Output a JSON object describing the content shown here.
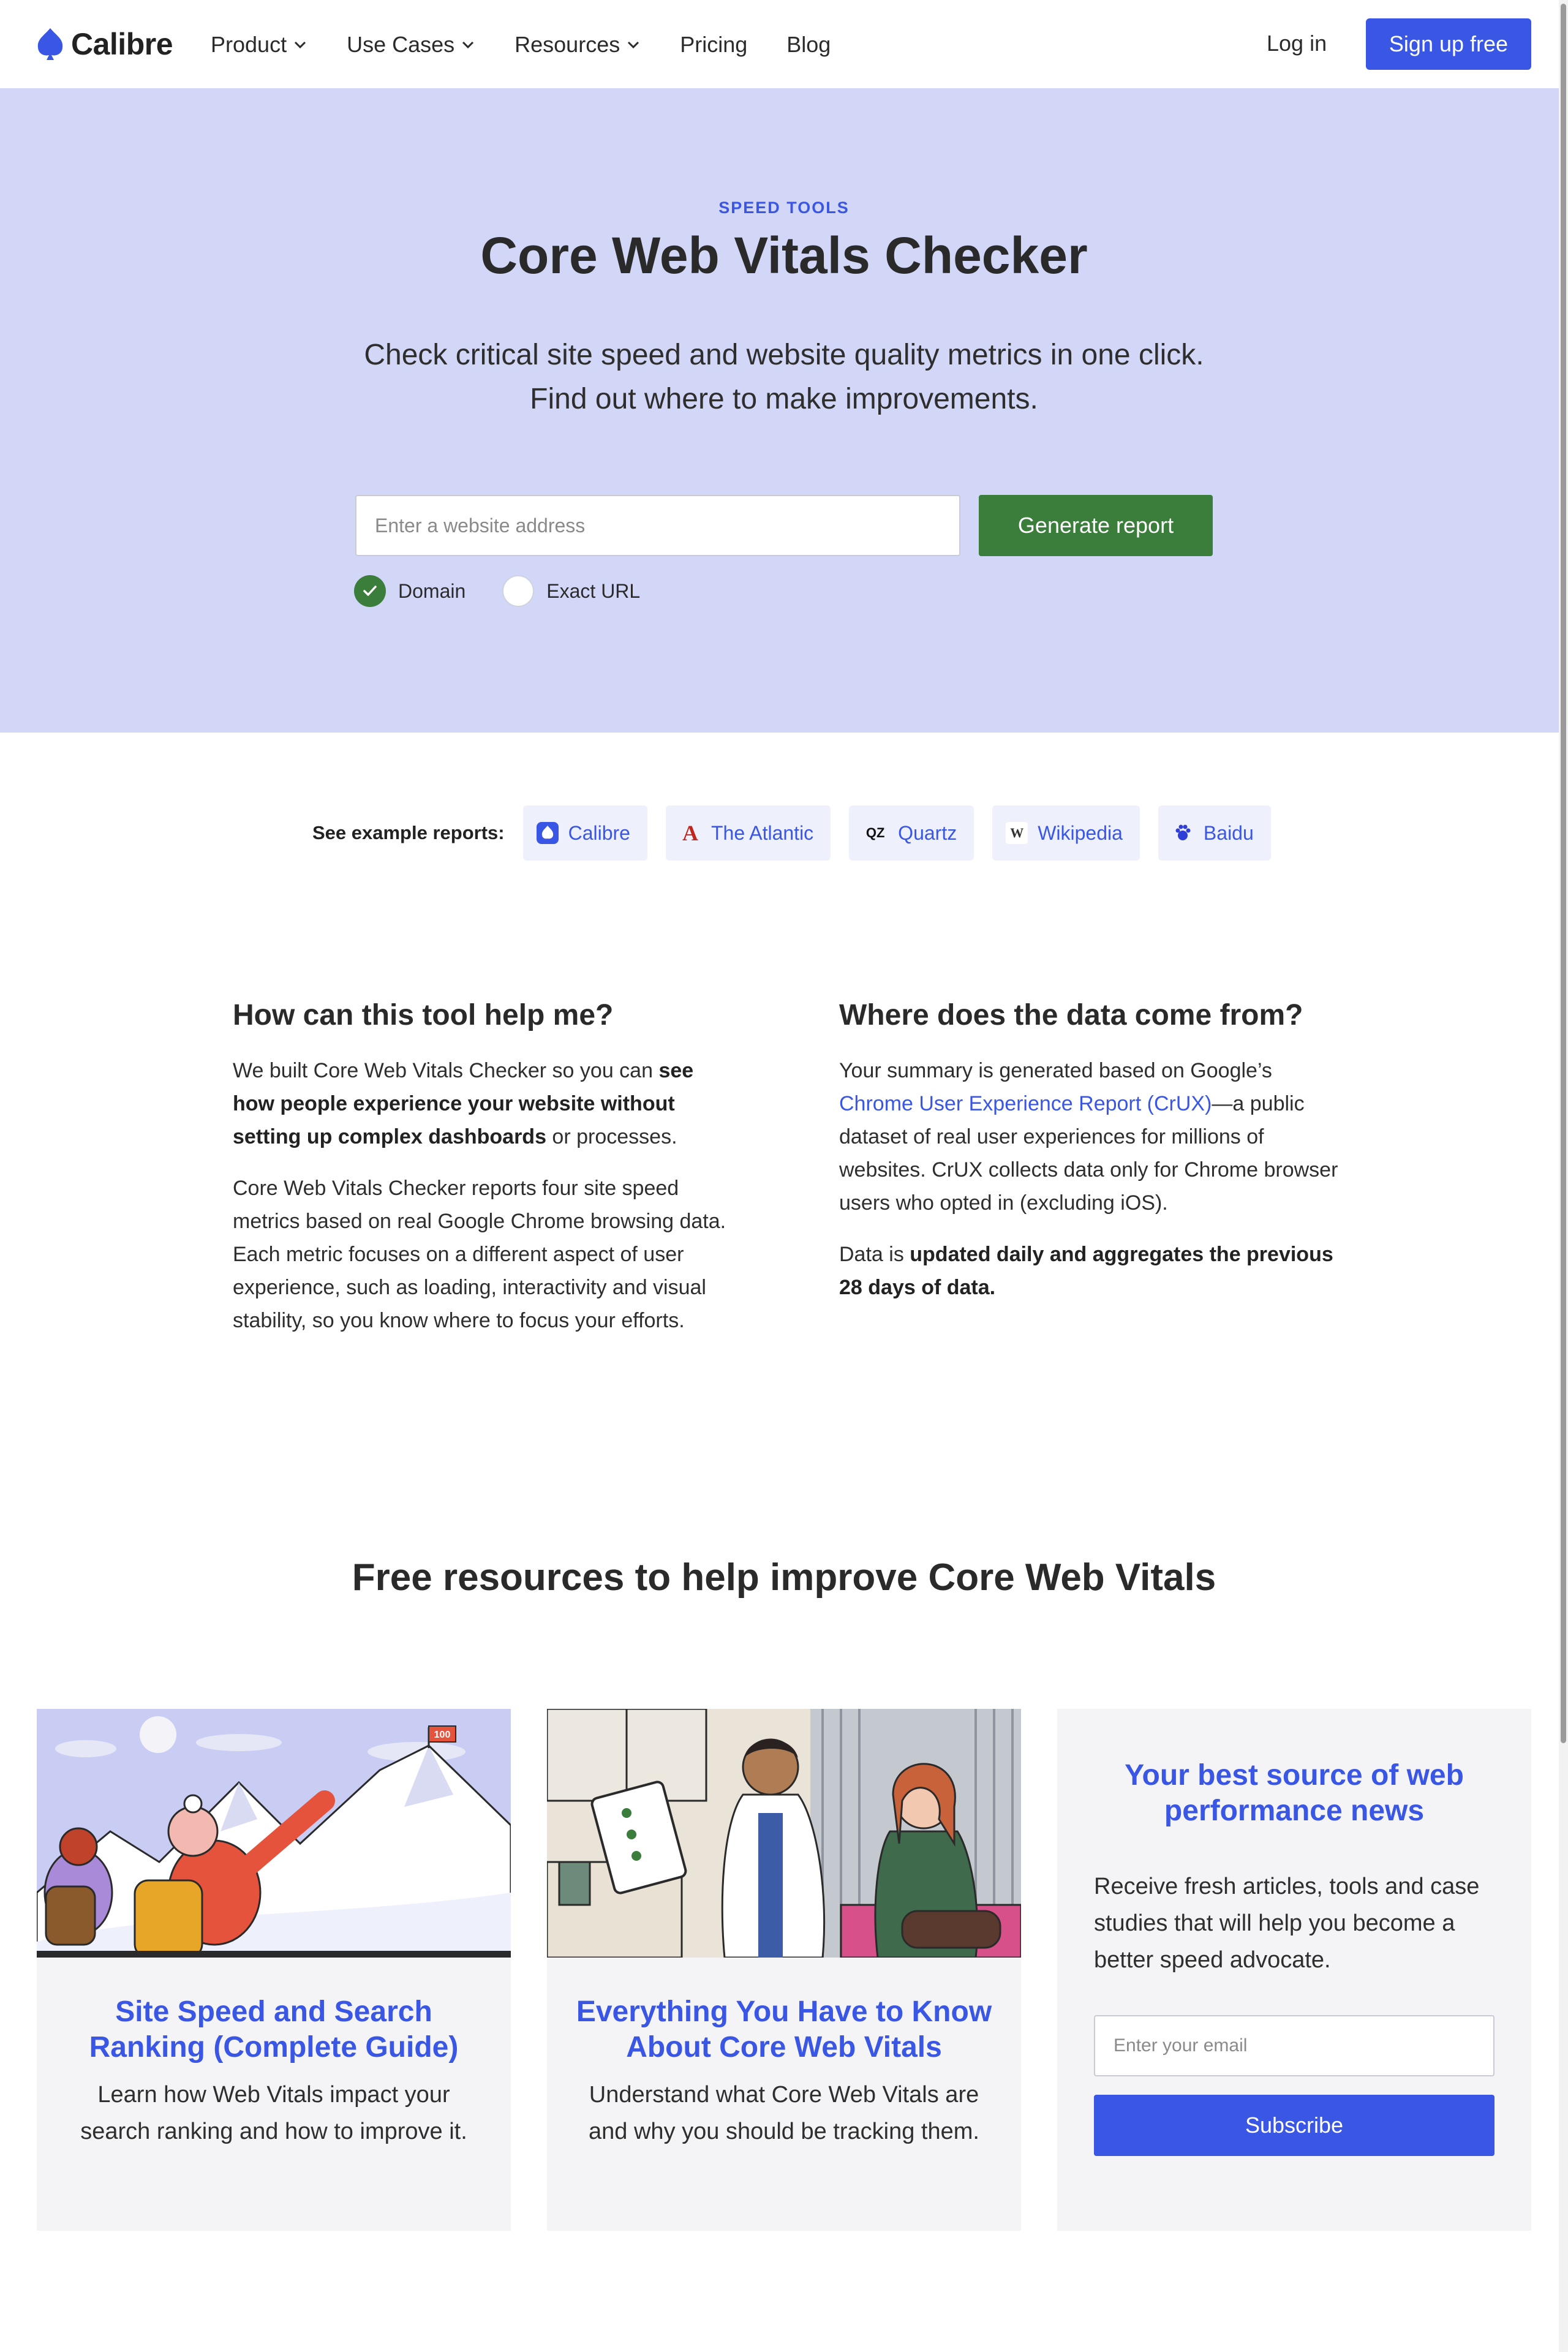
{
  "nav": {
    "brand": "Calibre",
    "menu": [
      {
        "label": "Product",
        "dropdown": true
      },
      {
        "label": "Use Cases",
        "dropdown": true
      },
      {
        "label": "Resources",
        "dropdown": true
      },
      {
        "label": "Pricing",
        "dropdown": false
      },
      {
        "label": "Blog",
        "dropdown": false
      }
    ],
    "login": "Log in",
    "signup": "Sign up free"
  },
  "hero": {
    "eyebrow": "SPEED TOOLS",
    "title": "Core Web Vitals Checker",
    "subtitle_line1": "Check critical site speed and website quality metrics in one click.",
    "subtitle_line2": "Find out where to make improvements.",
    "input_placeholder": "Enter a website address",
    "button": "Generate report",
    "radio_domain": "Domain",
    "radio_exact": "Exact URL",
    "selected_option": "Domain"
  },
  "examples": {
    "label": "See example reports:",
    "items": [
      {
        "name": "Calibre",
        "icon": "calibre-logo-icon"
      },
      {
        "name": "The Atlantic",
        "icon": "atlantic-logo-icon"
      },
      {
        "name": "Quartz",
        "icon": "quartz-logo-icon"
      },
      {
        "name": "Wikipedia",
        "icon": "wikipedia-logo-icon"
      },
      {
        "name": "Baidu",
        "icon": "baidu-logo-icon"
      }
    ]
  },
  "help": {
    "heading": "How can this tool help me?",
    "p1_pre": "We built Core Web Vitals Checker so you can ",
    "p1_bold": "see how people experience your website without setting up complex dashboards",
    "p1_post": " or processes.",
    "p2": "Core Web Vitals Checker reports four site speed metrics based on real Google Chrome browsing data. Each metric focuses on a different aspect of user experience, such as loading, interactivity and visual stability, so you know where to focus your efforts."
  },
  "data_source": {
    "heading": "Where does the data come from?",
    "p1_pre": "Your summary is generated based on Google’s ",
    "p1_link": "Chrome User Experience Report (CrUX)",
    "p1_post": "—a public dataset of real user experiences for millions of websites. CrUX collects data only for Chrome browser users who opted in (excluding iOS).",
    "p2_pre": "Data is ",
    "p2_bold": "updated daily and aggregates the previous 28 days of data."
  },
  "resources": {
    "heading": "Free resources to help improve Core Web Vitals",
    "cards": [
      {
        "title": "Site Speed and Search Ranking (Complete Guide)",
        "desc": "Learn how Web Vitals impact your search ranking and how to improve it.",
        "flag_text": "100"
      },
      {
        "title": "Everything You Have to Know About Core Web Vitals",
        "desc": "Understand what Core Web Vitals are and why you should be tracking them."
      }
    ],
    "newsletter": {
      "title": "Your best source of web performance news",
      "desc": "Receive fresh articles, tools and case studies that will help you become a better speed advocate.",
      "placeholder": "Enter your email",
      "button": "Subscribe"
    }
  },
  "colors": {
    "accent": "#3a56e4",
    "hero_bg": "#d2d7f8",
    "green": "#3b7d3b"
  }
}
